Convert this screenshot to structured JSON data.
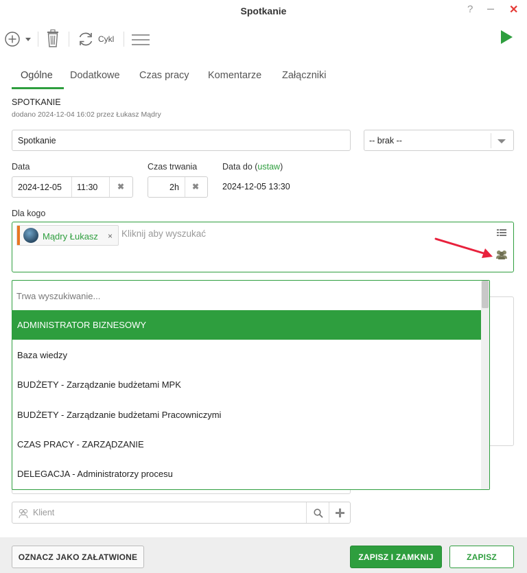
{
  "window": {
    "title": "Spotkanie",
    "help": "?",
    "minimize": "–",
    "close": "✕"
  },
  "toolbar": {
    "cycle_label": "Cykl"
  },
  "tabs": [
    "Ogólne",
    "Dodatkowe",
    "Czas pracy",
    "Komentarze",
    "Załączniki"
  ],
  "header": {
    "title": "SPOTKANIE",
    "added": "dodano 2024-12-04 16:02  przez Łukasz Mądry"
  },
  "form": {
    "subject_value": "Spotkanie",
    "category_value": "-- brak --",
    "date_label": "Data",
    "date_value": "2024-12-05",
    "time_value": "11:30",
    "duration_label": "Czas trwania",
    "duration_value": "2h",
    "date_to_label": "Data do (",
    "date_to_link": "ustaw",
    "date_to_close": ")",
    "date_to_value": "2024-12-05 13:30",
    "for_who_label": "Dla kogo",
    "person_name": "Mądry Łukasz",
    "person_remove": "×",
    "search_placeholder": "Kliknij aby wyszukać",
    "client_placeholder": "Klient"
  },
  "dropdown": {
    "searching": "Trwa wyszukiwanie...",
    "items": [
      "ADMINISTRATOR BIZNESOWY",
      "Baza wiedzy",
      "BUDŻETY - Zarządzanie budżetami MPK",
      "BUDŻETY - Zarządzanie budżetami Pracowniczymi",
      "CZAS PRACY - ZARZĄDZANIE",
      "DELEGACJA - Administratorzy procesu"
    ]
  },
  "footer": {
    "mark_done": "OZNACZ JAKO ZAŁATWIONE",
    "save_close": "ZAPISZ I ZAMKNIJ",
    "save": "ZAPISZ"
  },
  "colors": {
    "accent": "#2e9e3e",
    "danger": "#e53935",
    "tag_bar": "#e87722",
    "annotation_arrow": "#e8213c"
  }
}
